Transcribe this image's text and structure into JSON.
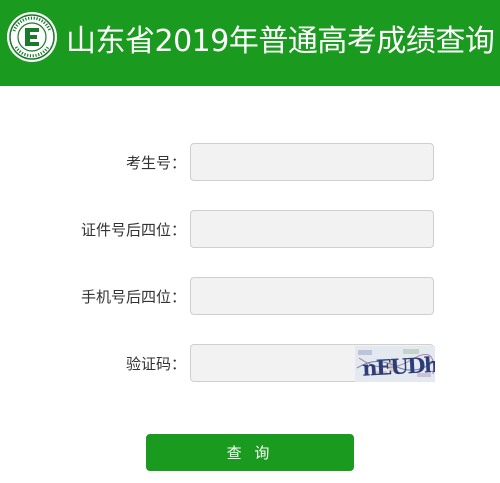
{
  "header": {
    "title": "山东省2019年普通高考成绩查询",
    "logo_icon": "exam-authority-seal-icon",
    "background": "#1a9a1f"
  },
  "form": {
    "fields": [
      {
        "label": "考生号：",
        "value": "",
        "placeholder": ""
      },
      {
        "label": "证件号后四位：",
        "value": "",
        "placeholder": ""
      },
      {
        "label": "手机号后四位：",
        "value": "",
        "placeholder": ""
      },
      {
        "label": "验证码：",
        "value": "",
        "placeholder": ""
      }
    ],
    "captcha_text": "nEUDh",
    "submit_label": "查 询",
    "submit_color": "#1a9a1f"
  }
}
